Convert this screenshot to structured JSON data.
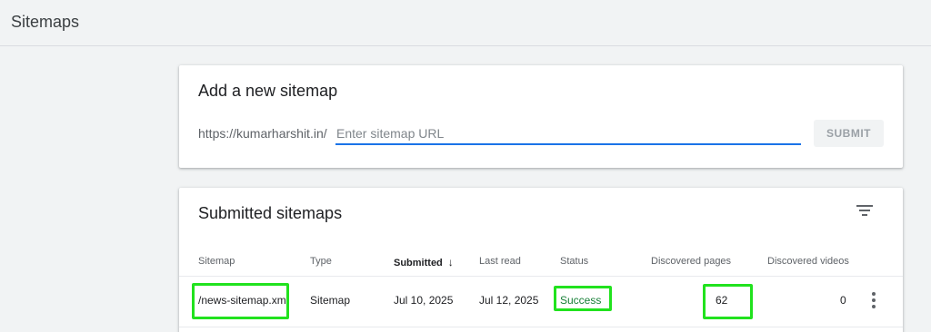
{
  "header": {
    "title": "Sitemaps"
  },
  "add_sitemap": {
    "title": "Add a new sitemap",
    "url_prefix": "https://kumarharshit.in/",
    "input_placeholder": "Enter sitemap URL",
    "input_value": "",
    "submit_label": "SUBMIT"
  },
  "submitted": {
    "title": "Submitted sitemaps",
    "filter_icon": "filter-list-icon",
    "columns": [
      "Sitemap",
      "Type",
      "Submitted",
      "Last read",
      "Status",
      "Discovered pages",
      "Discovered videos"
    ],
    "sort_arrow": "↓",
    "rows": [
      {
        "sitemap": "/news-sitemap.xml",
        "type": "Sitemap",
        "submitted": "Jul 10, 2025",
        "last_read": "Jul 12, 2025",
        "status": "Success",
        "discovered_pages": "62",
        "discovered_videos": "0"
      }
    ]
  },
  "colors": {
    "accent": "#1a73e8",
    "success": "#188038",
    "highlight": "#21e21e"
  }
}
